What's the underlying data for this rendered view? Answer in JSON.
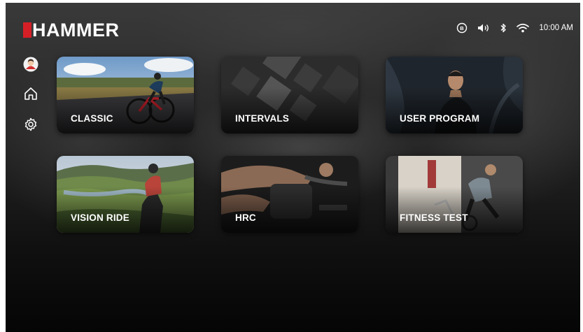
{
  "brand": {
    "name": "HAMMER",
    "accent": "#d51f26"
  },
  "status_bar": {
    "icons": [
      "hammer-badge-icon",
      "volume-icon",
      "bluetooth-icon",
      "wifi-icon"
    ],
    "time": "10:00 AM"
  },
  "sidebar": {
    "items": [
      {
        "name": "avatar",
        "icon": "user-avatar-icon"
      },
      {
        "name": "home",
        "icon": "home-icon"
      },
      {
        "name": "settings",
        "icon": "gear-icon"
      }
    ]
  },
  "programs": [
    {
      "label": "CLASSIC"
    },
    {
      "label": "INTERVALS"
    },
    {
      "label": "USER PROGRAM"
    },
    {
      "label": "VISION RIDE"
    },
    {
      "label": "HRC"
    },
    {
      "label": "FITNESS TEST"
    }
  ]
}
